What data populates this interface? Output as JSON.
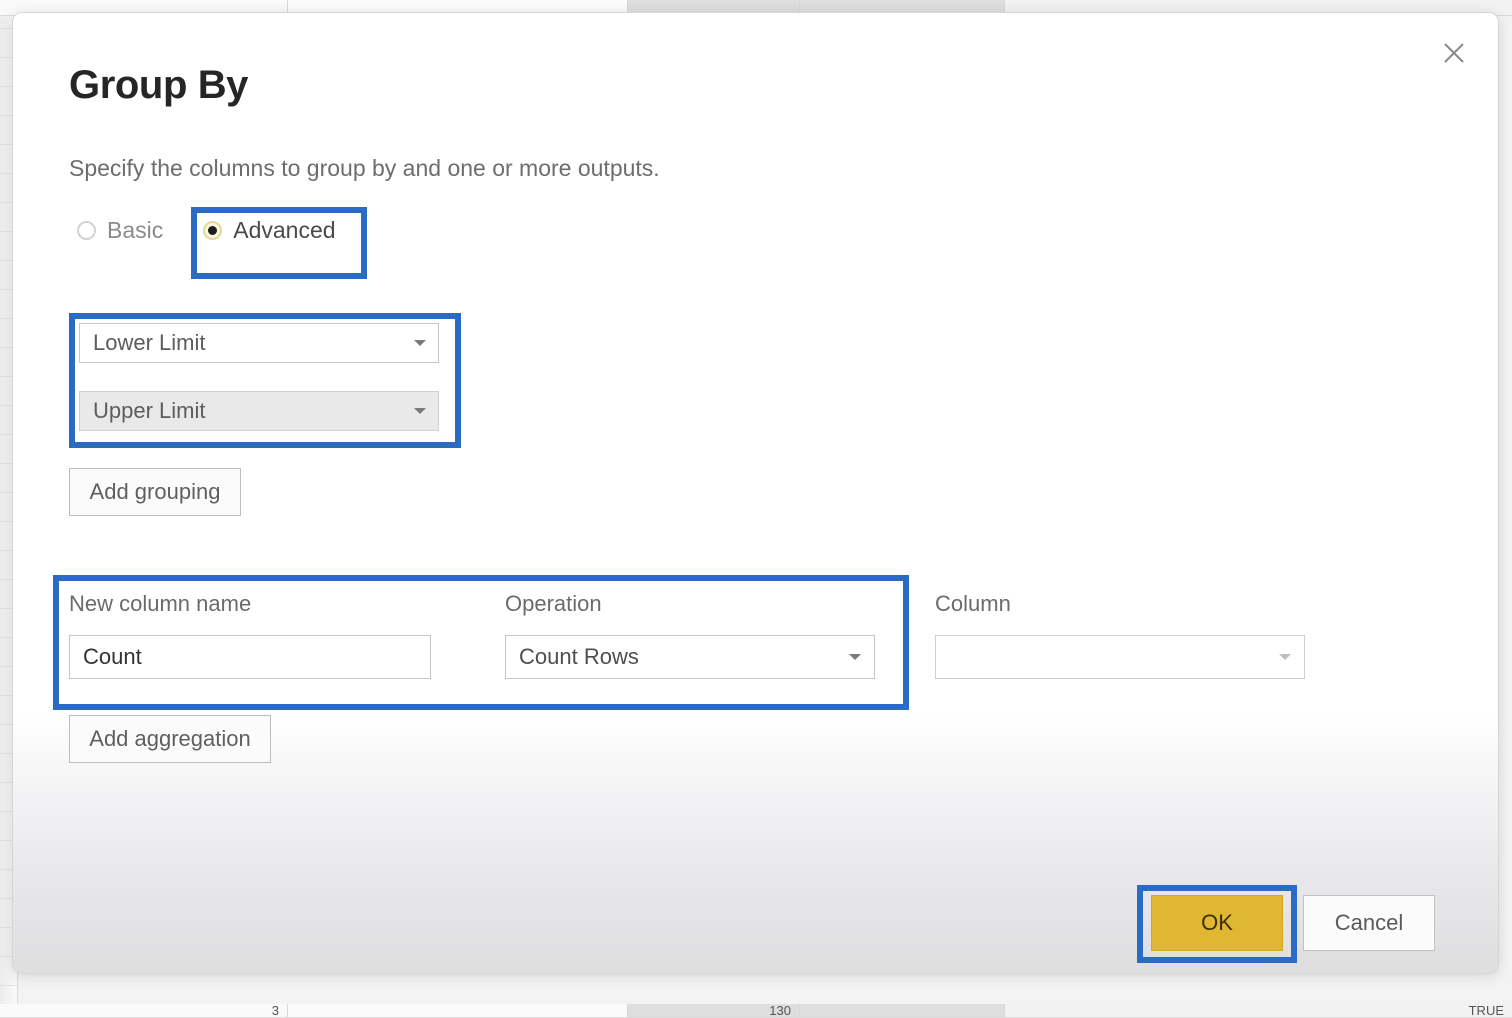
{
  "dialog": {
    "title": "Group By",
    "subtitle": "Specify the columns to group by and one or more outputs.",
    "close_icon": "close-icon"
  },
  "mode": {
    "options": [
      {
        "label": "Basic",
        "selected": false
      },
      {
        "label": "Advanced",
        "selected": true
      }
    ],
    "selected": "Advanced"
  },
  "group_columns": {
    "rows": [
      {
        "value": "Lower Limit",
        "state": "normal"
      },
      {
        "value": "Upper Limit",
        "state": "hover"
      }
    ],
    "add_button_label": "Add grouping"
  },
  "aggregations": {
    "headers": {
      "new_column_name": "New column name",
      "operation": "Operation",
      "column": "Column"
    },
    "rows": [
      {
        "new_column_name": "Count",
        "operation": "Count Rows",
        "column": ""
      }
    ],
    "add_button_label": "Add aggregation"
  },
  "footer": {
    "ok_label": "OK",
    "cancel_label": "Cancel"
  },
  "highlights": {
    "color": "#2a6cc4",
    "targets": [
      "advanced-radio",
      "group-by-columns",
      "aggregation-row",
      "ok-button"
    ]
  },
  "colors": {
    "accent_blue": "#2a6cc4",
    "ok_gold": "#e0b732",
    "radio_ring": "#e4d79a",
    "dialog_bg_top": "#ffffff",
    "dialog_bg_bottom": "#dededf"
  },
  "background_grid": {
    "top_row": [
      "",
      "",
      "",
      "",
      ""
    ],
    "bottom_row": [
      "3",
      "",
      "130",
      "",
      "TRUE"
    ]
  }
}
